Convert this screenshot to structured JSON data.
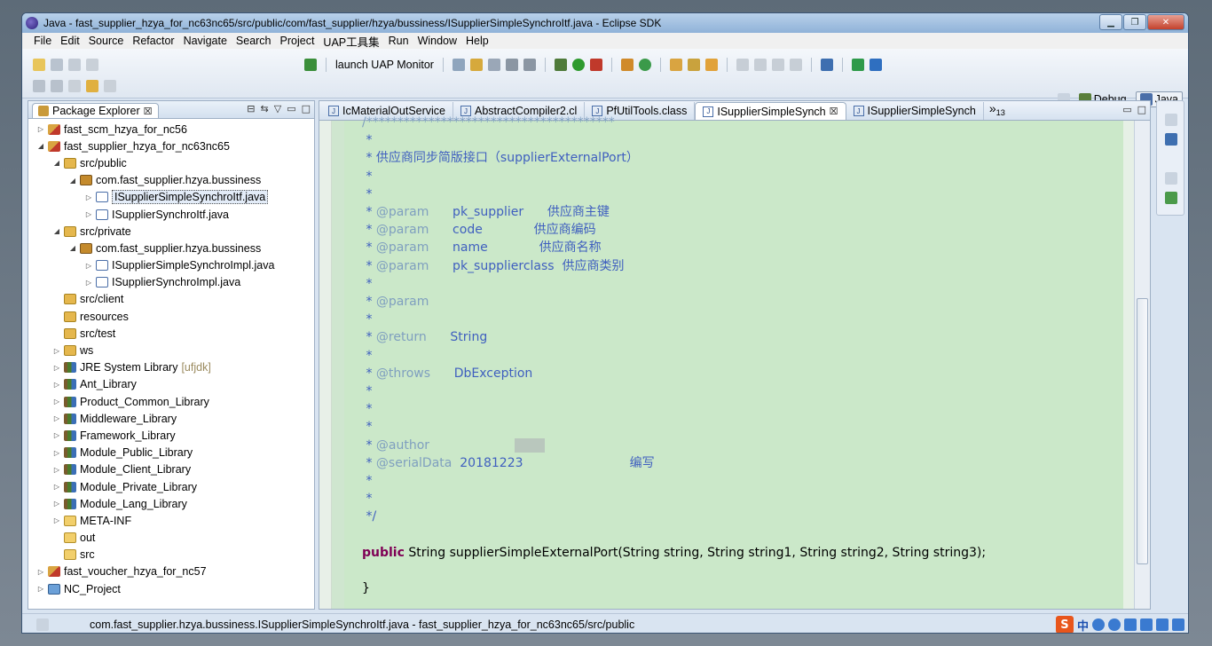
{
  "window": {
    "title": "Java - fast_supplier_hzya_for_nc63nc65/src/public/com/fast_supplier/hzya/bussiness/ISupplierSimpleSynchroItf.java - Eclipse SDK",
    "minimize": "▁",
    "restore": "❐",
    "close": "✕"
  },
  "menu": [
    "File",
    "Edit",
    "Source",
    "Refactor",
    "Navigate",
    "Search",
    "Project",
    "UAP工具集",
    "Run",
    "Window",
    "Help"
  ],
  "toolbar": {
    "launch_label": "launch UAP Monitor"
  },
  "perspectives": {
    "debug": "Debug",
    "java": "Java"
  },
  "explorer": {
    "title": "Package Explorer",
    "close_glyph": "☒",
    "items": [
      {
        "label": "fast_scm_hzya_for_nc56",
        "level": 0,
        "arrow": "▷",
        "icon": "project"
      },
      {
        "label": "fast_supplier_hzya_for_nc63nc65",
        "level": 0,
        "arrow": "◢",
        "icon": "project"
      },
      {
        "label": "src/public",
        "level": 1,
        "arrow": "◢",
        "icon": "src"
      },
      {
        "label": "com.fast_supplier.hzya.bussiness",
        "level": 2,
        "arrow": "◢",
        "icon": "pkg"
      },
      {
        "label": "ISupplierSimpleSynchroItf.java",
        "level": 3,
        "arrow": "▷",
        "icon": "java",
        "selected": true
      },
      {
        "label": "ISupplierSynchroItf.java",
        "level": 3,
        "arrow": "▷",
        "icon": "java"
      },
      {
        "label": "src/private",
        "level": 1,
        "arrow": "◢",
        "icon": "src"
      },
      {
        "label": "com.fast_supplier.hzya.bussiness",
        "level": 2,
        "arrow": "◢",
        "icon": "pkg"
      },
      {
        "label": "ISupplierSimpleSynchroImpl.java",
        "level": 3,
        "arrow": "▷",
        "icon": "java"
      },
      {
        "label": "ISupplierSynchroImpl.java",
        "level": 3,
        "arrow": "▷",
        "icon": "java"
      },
      {
        "label": "src/client",
        "level": 1,
        "arrow": "",
        "icon": "src"
      },
      {
        "label": "resources",
        "level": 1,
        "arrow": "",
        "icon": "src"
      },
      {
        "label": "src/test",
        "level": 1,
        "arrow": "",
        "icon": "src"
      },
      {
        "label": "ws",
        "level": 1,
        "arrow": "▷",
        "icon": "src"
      },
      {
        "label": "JRE System Library",
        "level": 1,
        "arrow": "▷",
        "icon": "lib",
        "suffix": "[ufjdk]"
      },
      {
        "label": "Ant_Library",
        "level": 1,
        "arrow": "▷",
        "icon": "lib"
      },
      {
        "label": "Product_Common_Library",
        "level": 1,
        "arrow": "▷",
        "icon": "lib"
      },
      {
        "label": "Middleware_Library",
        "level": 1,
        "arrow": "▷",
        "icon": "lib"
      },
      {
        "label": "Framework_Library",
        "level": 1,
        "arrow": "▷",
        "icon": "lib"
      },
      {
        "label": "Module_Public_Library",
        "level": 1,
        "arrow": "▷",
        "icon": "lib"
      },
      {
        "label": "Module_Client_Library",
        "level": 1,
        "arrow": "▷",
        "icon": "lib"
      },
      {
        "label": "Module_Private_Library",
        "level": 1,
        "arrow": "▷",
        "icon": "lib"
      },
      {
        "label": "Module_Lang_Library",
        "level": 1,
        "arrow": "▷",
        "icon": "lib"
      },
      {
        "label": "META-INF",
        "level": 1,
        "arrow": "▷",
        "icon": "folder"
      },
      {
        "label": "out",
        "level": 1,
        "arrow": "",
        "icon": "folder"
      },
      {
        "label": "src",
        "level": 1,
        "arrow": "",
        "icon": "folder"
      },
      {
        "label": "fast_voucher_hzya_for_nc57",
        "level": 0,
        "arrow": "▷",
        "icon": "project"
      },
      {
        "label": "NC_Project",
        "level": 0,
        "arrow": "▷",
        "icon": "nc"
      }
    ]
  },
  "editor": {
    "tabs": [
      {
        "label": "IcMaterialOutService",
        "active": false
      },
      {
        "label": "AbstractCompiler2.cl",
        "active": false
      },
      {
        "label": "PfUtilTools.class",
        "active": false
      },
      {
        "label": "ISupplierSimpleSynch",
        "active": true,
        "close": "☒"
      },
      {
        "label": "ISupplierSimpleSynch",
        "active": false
      }
    ],
    "more": "»",
    "more_count": "13",
    "code_lines": [
      {
        "t": "/****************************************",
        "cls": "tag"
      },
      {
        "t": " *"
      },
      {
        "t": " * 供应商同步简版接口（supplierExternalPort）"
      },
      {
        "t": " *"
      },
      {
        "t": " *"
      },
      {
        "t": " * ",
        "tag": "@param",
        "rest": "      pk_supplier      供应商主键"
      },
      {
        "t": " * ",
        "tag": "@param",
        "rest": "      code             供应商编码"
      },
      {
        "t": " * ",
        "tag": "@param",
        "rest": "      name             供应商名称"
      },
      {
        "t": " * ",
        "tag": "@param",
        "rest": "      pk_supplierclass  供应商类别"
      },
      {
        "t": " *"
      },
      {
        "t": " * ",
        "tag": "@param",
        "rest": ""
      },
      {
        "t": " *"
      },
      {
        "t": " * ",
        "tag": "@return",
        "rest": "      String"
      },
      {
        "t": " *"
      },
      {
        "t": " * ",
        "tag": "@throws",
        "rest": "      DbException"
      },
      {
        "t": " *"
      },
      {
        "t": " *"
      },
      {
        "t": " *"
      },
      {
        "t": " * ",
        "tag": "@author",
        "rest": "",
        "blur": true
      },
      {
        "t": " * ",
        "tag": "@serialData",
        "rest": "  20181223                           编写"
      },
      {
        "t": " *"
      },
      {
        "t": " *"
      },
      {
        "t": " */"
      },
      {
        "t": ""
      },
      {
        "kw": "public",
        "rest": " String supplierSimpleExternalPort(String string, String string1, String string2, String string3);"
      },
      {
        "t": ""
      },
      {
        "t": "}",
        "cls": "plain"
      }
    ]
  },
  "status": {
    "text": "com.fast_supplier.hzya.bussiness.ISupplierSimpleSynchroItf.java - fast_supplier_hzya_for_nc63nc65/src/public",
    "ime_logo": "S",
    "ime_lang": "中"
  },
  "colors": {
    "code_background": "#cbe8c9",
    "comment": "#3f5fbf",
    "javadoc_tag": "#7f9fbf",
    "keyword": "#7f0055"
  }
}
